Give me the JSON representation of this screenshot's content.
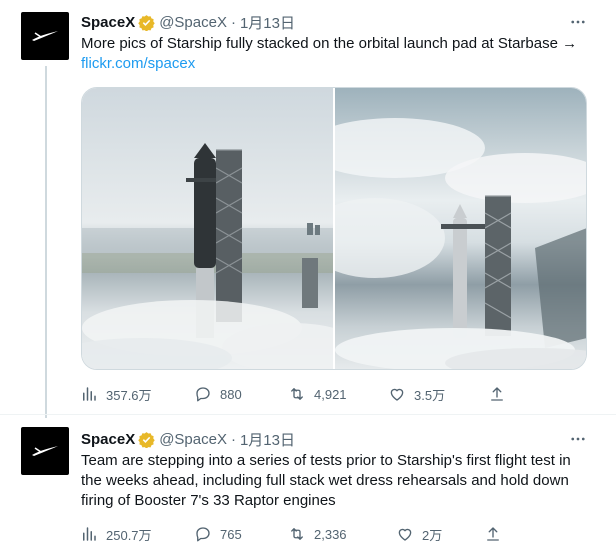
{
  "tweets": [
    {
      "author": "SpaceX",
      "handle": "@SpaceX",
      "separator": "·",
      "date": "1月13日",
      "text": "More pics of Starship fully stacked on the orbital launch pad at Starbase →",
      "link": "flickr.com/spacex",
      "stats": {
        "views": "357.6万",
        "replies": "880",
        "retweets": "4,921",
        "likes": "3.5万"
      }
    },
    {
      "author": "SpaceX",
      "handle": "@SpaceX",
      "separator": "·",
      "date": "1月13日",
      "text": "Team are stepping into a series of tests prior to Starship's first flight test in the weeks ahead, including full stack wet dress rehearsals and hold down firing of Booster 7's 33 Raptor engines",
      "stats": {
        "views": "250.7万",
        "replies": "765",
        "retweets": "2,336",
        "likes": "2万"
      }
    }
  ],
  "colors": {
    "verified_badge": "#e8b828",
    "link": "#1d9bf0",
    "secondary_text": "#536471",
    "thread_line": "#cfd9de"
  },
  "icons": [
    "spacex-logo-icon",
    "verified-badge-icon",
    "more-icon",
    "views-icon",
    "reply-icon",
    "retweet-icon",
    "like-icon",
    "share-icon"
  ]
}
